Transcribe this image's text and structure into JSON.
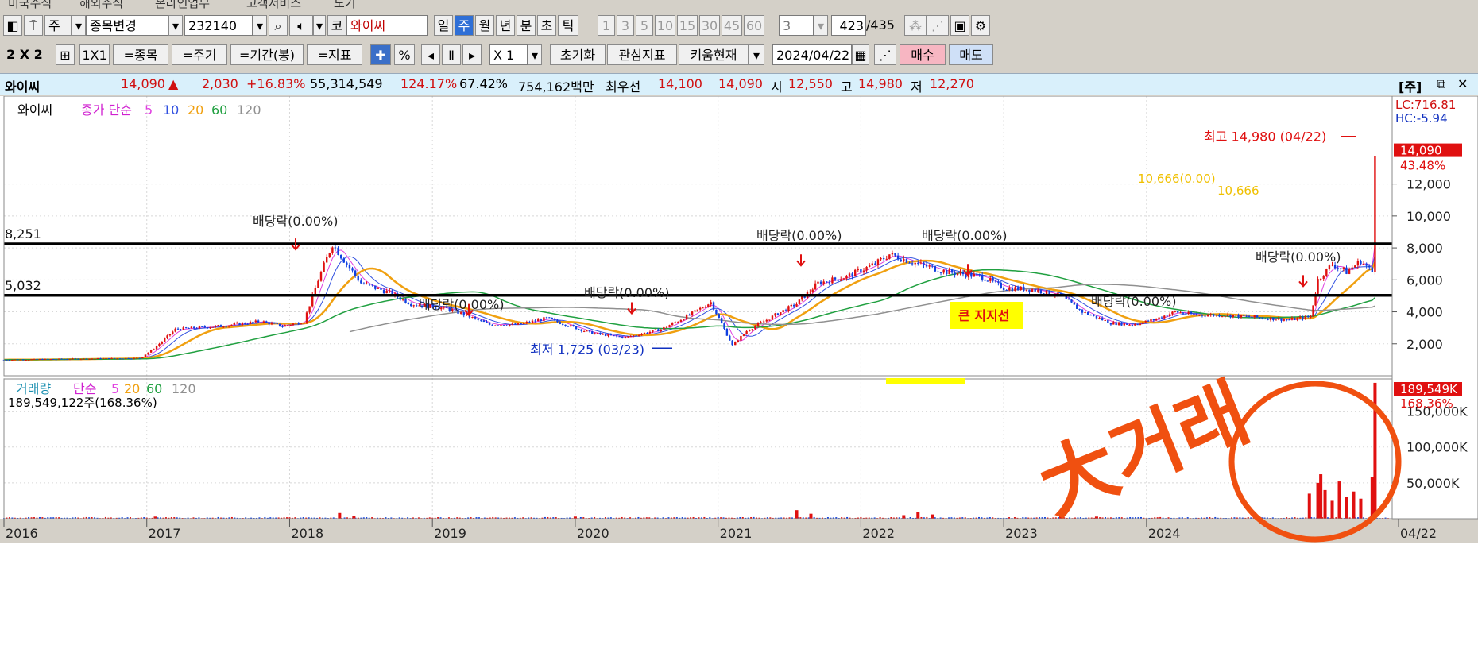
{
  "top_menu": [
    "미국주식",
    "해외주식",
    "온라인업무",
    "고객서비스",
    "도기"
  ],
  "toolbar1": {
    "period_unit": "주",
    "change_stock": "종목변경",
    "code": "232140",
    "stock_name": "와이씨",
    "market_tag": "코",
    "periods": [
      "일",
      "주",
      "월",
      "년",
      "분",
      "초",
      "틱"
    ],
    "selected_period": "주",
    "minute_steps": [
      "1",
      "3",
      "5",
      "10",
      "15",
      "30",
      "45",
      "60"
    ],
    "count_select": "3",
    "page_current": "423",
    "page_total": "/435"
  },
  "toolbar2": {
    "layout_label": "2 X 2",
    "one_by_one": "1X1",
    "same_stock": "=종목",
    "same_period": "=주기",
    "same_range": "=기간(봉)",
    "same_indicator": "=지표",
    "percent": "%",
    "multiplier": "X 1",
    "reset": "초기화",
    "watch_indicator": "관심지표",
    "kiwoom_now": "키움현재",
    "date": "2024/04/22",
    "buy": "매수",
    "sell": "매도"
  },
  "infobar": {
    "name": "와이씨",
    "price": "14,090",
    "up_arrow": "▲",
    "change": "2,030",
    "change_pct": "+16.83%",
    "volume": "55,314,549",
    "vol_ratio": "124.17%",
    "turnover": "67.42%",
    "amount": "754,162백만",
    "best_bid_label": "최우선",
    "best_ask": "14,100",
    "best_bid": "14,090",
    "open_label": "시",
    "open": "12,550",
    "high_label": "고",
    "high": "14,980",
    "low_label": "저",
    "low": "12,270",
    "jung_label": "[주]"
  },
  "colors": {
    "up": "#e01010",
    "down": "#1040e0",
    "ma5": "#e040e0",
    "ma10": "#3050e0",
    "ma20": "#f0a010",
    "ma60": "#20a040",
    "ma120": "#909090",
    "support": "#000000",
    "annotation": "#f05010"
  },
  "chart_data": {
    "type": "candlestick",
    "stock": "와이씨",
    "price_legend": {
      "name": "와이씨",
      "label": "종가 단순",
      "ma": [
        "5",
        "10",
        "20",
        "60",
        "120"
      ]
    },
    "volume_legend": {
      "label": "거래량",
      "type": "단순",
      "ma": [
        "5",
        "20",
        "60",
        "120"
      ],
      "summary": "189,549,122주(168.36%)"
    },
    "x_years": [
      "2016",
      "2017",
      "2018",
      "2019",
      "2020",
      "2021",
      "2022",
      "2023",
      "2024",
      "04/22"
    ],
    "price_ticks": [
      "12,000",
      "10,000",
      "8,000",
      "6,000",
      "4,000",
      "2,000"
    ],
    "price_ylim": [
      0,
      17500
    ],
    "volume_ticks": [
      "150,000K",
      "100,000K",
      "50,000K"
    ],
    "volume_ylim": [
      0,
      195000
    ],
    "right_labels": {
      "lc": "LC:716.81",
      "hc": "HC:-5.94",
      "price": "14,090",
      "price_pct": "43.48%",
      "volume": "189,549K",
      "volume_pct": "168.36%"
    },
    "support_lines": [
      {
        "label": "8,251",
        "value": 8251
      },
      {
        "label": "5,032",
        "value": 5032
      }
    ],
    "price_path": [
      [
        2016.0,
        1000
      ],
      [
        2016.5,
        1050
      ],
      [
        2016.95,
        1100
      ],
      [
        2017.05,
        1700
      ],
      [
        2017.2,
        2900
      ],
      [
        2017.5,
        3100
      ],
      [
        2017.8,
        3400
      ],
      [
        2017.95,
        3100
      ],
      [
        2018.1,
        3400
      ],
      [
        2018.2,
        6000
      ],
      [
        2018.3,
        8250
      ],
      [
        2018.4,
        7000
      ],
      [
        2018.5,
        5800
      ],
      [
        2018.7,
        5200
      ],
      [
        2018.85,
        4500
      ],
      [
        2019.1,
        4200
      ],
      [
        2019.2,
        3900
      ],
      [
        2019.4,
        3200
      ],
      [
        2019.6,
        3200
      ],
      [
        2019.8,
        3600
      ],
      [
        2020.1,
        2700
      ],
      [
        2020.25,
        2500
      ],
      [
        2020.35,
        2400
      ],
      [
        2020.6,
        2900
      ],
      [
        2020.8,
        3800
      ],
      [
        2020.95,
        4600
      ],
      [
        2021.1,
        1900
      ],
      [
        2021.2,
        2800
      ],
      [
        2021.4,
        3800
      ],
      [
        2021.55,
        4500
      ],
      [
        2021.7,
        5800
      ],
      [
        2021.9,
        6200
      ],
      [
        2022.1,
        7000
      ],
      [
        2022.2,
        7600
      ],
      [
        2022.4,
        7000
      ],
      [
        2022.6,
        6500
      ],
      [
        2022.85,
        6200
      ],
      [
        2023.0,
        5500
      ],
      [
        2023.2,
        5400
      ],
      [
        2023.4,
        5000
      ],
      [
        2023.55,
        4000
      ],
      [
        2023.75,
        3300
      ],
      [
        2023.9,
        3200
      ],
      [
        2024.05,
        3500
      ],
      [
        2024.2,
        4000
      ],
      [
        2024.35,
        3800
      ],
      [
        2024.55,
        3800
      ],
      [
        2024.7,
        3700
      ],
      [
        2024.85,
        3600
      ],
      [
        2025.0,
        3500
      ],
      [
        2025.15,
        3700
      ],
      [
        2025.2,
        6000
      ],
      [
        2025.3,
        7000
      ],
      [
        2025.4,
        6500
      ],
      [
        2025.5,
        7200
      ],
      [
        2025.58,
        6500
      ],
      [
        2025.6,
        14090
      ]
    ],
    "volume_bars": [
      [
        2017.06,
        3000
      ],
      [
        2018.35,
        8000
      ],
      [
        2018.45,
        4000
      ],
      [
        2020.0,
        3000
      ],
      [
        2021.55,
        12000
      ],
      [
        2021.65,
        7000
      ],
      [
        2022.3,
        5000
      ],
      [
        2022.4,
        9000
      ],
      [
        2022.5,
        6000
      ],
      [
        2023.4,
        4000
      ],
      [
        2023.65,
        3000
      ],
      [
        2025.14,
        35000
      ],
      [
        2025.2,
        50000
      ],
      [
        2025.22,
        62000
      ],
      [
        2025.25,
        40000
      ],
      [
        2025.3,
        25000
      ],
      [
        2025.35,
        52000
      ],
      [
        2025.4,
        30000
      ],
      [
        2025.45,
        38000
      ],
      [
        2025.5,
        28000
      ],
      [
        2025.58,
        58000
      ],
      [
        2025.6,
        189549
      ]
    ],
    "annotations": {
      "high": "최고 14,980 (04/22)",
      "low": "최저 1,725 (03/23)",
      "dividend": "배당락(0.00%)",
      "support_note": "큰 지지선",
      "hline_label1": "10,666(0.00)",
      "hline_label2": "10,666",
      "big_volume": "大거래"
    }
  }
}
